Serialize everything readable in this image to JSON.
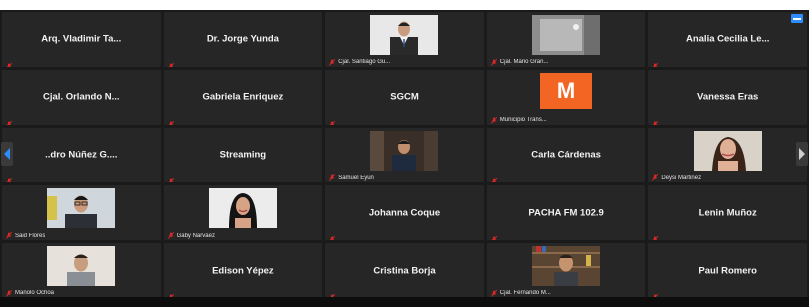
{
  "participants": [
    {
      "type": "name",
      "name": "Arq. Vladimir Ta..."
    },
    {
      "type": "name",
      "name": "Dr. Jorge Yunda"
    },
    {
      "type": "video",
      "label": "Cjal. Santiago Gu...",
      "scene": "man-suit"
    },
    {
      "type": "video",
      "label": "Cjal. Mario Gran...",
      "scene": "room"
    },
    {
      "type": "name",
      "name": "Analia Cecilia Le...",
      "badge": true
    },
    {
      "type": "name",
      "name": "Cjal. Orlando N..."
    },
    {
      "type": "name",
      "name": "Gabriela Enriquez"
    },
    {
      "type": "name",
      "name": "SGCM"
    },
    {
      "type": "logo",
      "label": "Municipio Trans...",
      "logo_letter": "M",
      "logo_color": "#f26522"
    },
    {
      "type": "name",
      "name": "Vanessa Eras"
    },
    {
      "type": "name",
      "name": "..dro Núñez G...."
    },
    {
      "type": "name",
      "name": "Streaming"
    },
    {
      "type": "video",
      "label": "Samuel Eyun",
      "scene": "man-room"
    },
    {
      "type": "name",
      "name": "Carla Cárdenas"
    },
    {
      "type": "video",
      "label": "Deysi Martinez",
      "scene": "woman"
    },
    {
      "type": "video",
      "label": "Said Flores",
      "scene": "man-glasses"
    },
    {
      "type": "video",
      "label": "Gaby Narváez",
      "scene": "woman-dark"
    },
    {
      "type": "name",
      "name": "Johanna Coque"
    },
    {
      "type": "name",
      "name": "PACHA FM 102.9"
    },
    {
      "type": "name",
      "name": "Lenin Muñoz"
    },
    {
      "type": "video",
      "label": "Manolo Ochoa",
      "scene": "man-light"
    },
    {
      "type": "name",
      "name": "Edison Yépez"
    },
    {
      "type": "name",
      "name": "Cristina Borja"
    },
    {
      "type": "video",
      "label": "Cjal. Fernando M...",
      "scene": "man-shelves"
    },
    {
      "type": "name",
      "name": "Paul Romero"
    }
  ],
  "colors": {
    "tile_bg": "#262626",
    "muted_mic": "#e02828",
    "accent": "#2d8cff"
  },
  "icons": {
    "muted": "muted-mic-icon",
    "nav_prev": "chevron-left-icon",
    "nav_next": "chevron-right-icon"
  }
}
